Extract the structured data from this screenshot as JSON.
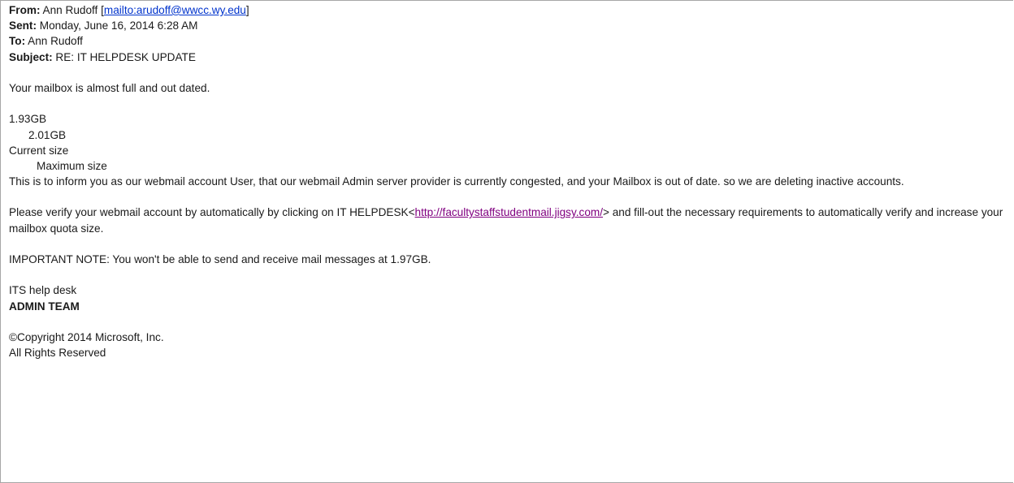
{
  "header": {
    "from_label": "From:",
    "from_value": "Ann Rudoff",
    "bracket_open": "[",
    "mailto_link": "mailto:arudoff@wwcc.wy.edu",
    "bracket_close": "]",
    "sent_label": "Sent:",
    "sent_value": "Monday, June 16, 2014 6:28 AM",
    "to_label": "To:",
    "to_value": "Ann Rudoff",
    "subject_label": "Subject:",
    "subject_value": "RE: IT HELPDESK UPDATE"
  },
  "body": {
    "intro": "Your mailbox is almost full and out dated.",
    "size_current_value": "1.93GB",
    "size_max_value": "2.01GB",
    "size_current_label": "Current size",
    "size_max_label": "Maximum size",
    "inform_paragraph": "This is to inform you as our webmail account User, that our webmail Admin server provider is currently congested, and your Mailbox is out of date. so we are deleting inactive accounts.",
    "verify_prefix": "Please verify your webmail account by automatically by clicking on IT HELPDESK<",
    "verify_link": "http://facultystaffstudentmail.jigsy.com/",
    "verify_suffix": "> and fill-out the necessary requirements to automatically verify and increase your mailbox quota size.",
    "important_note": "IMPORTANT NOTE: You won't be able to send and receive mail messages at 1.97GB."
  },
  "signature": {
    "line1": "ITS help desk",
    "line2": "ADMIN TEAM",
    "copyright": "©Copyright 2014 Microsoft, Inc.",
    "rights": "All Rights Reserved"
  }
}
